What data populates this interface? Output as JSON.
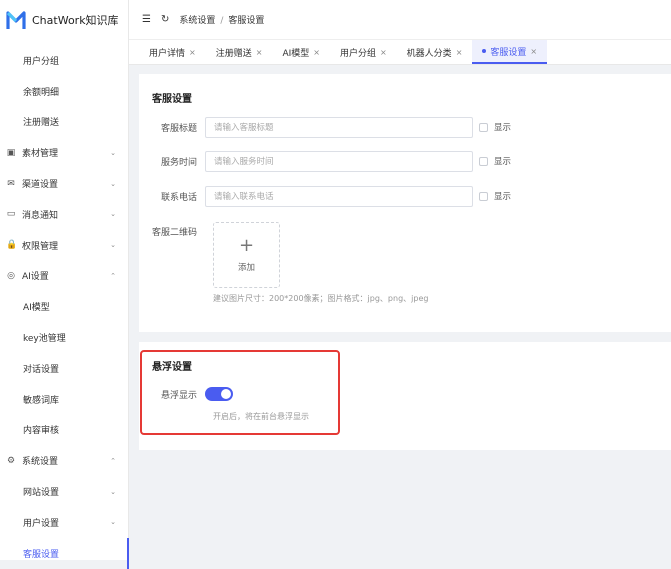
{
  "app": {
    "title": "ChatWork知识库"
  },
  "sidebar": {
    "items": [
      {
        "label": "用户分组",
        "kind": "sub"
      },
      {
        "label": "余额明细",
        "kind": "sub"
      },
      {
        "label": "注册赠送",
        "kind": "sub"
      },
      {
        "label": "素材管理",
        "kind": "grp",
        "icon": "image-icon",
        "glyph": "▣",
        "chev": "⌄"
      },
      {
        "label": "渠道设置",
        "kind": "grp",
        "icon": "mail-icon",
        "glyph": "✉",
        "chev": "⌄"
      },
      {
        "label": "消息通知",
        "kind": "grp",
        "icon": "message-icon",
        "glyph": "▭",
        "chev": "⌄"
      },
      {
        "label": "权限管理",
        "kind": "grp",
        "icon": "lock-icon",
        "glyph": "🔒",
        "chev": "⌄"
      },
      {
        "label": "AI设置",
        "kind": "grp",
        "icon": "ai-icon",
        "glyph": "◎",
        "chev": "⌃"
      },
      {
        "label": "AI模型",
        "kind": "sub"
      },
      {
        "label": "key池管理",
        "kind": "sub"
      },
      {
        "label": "对话设置",
        "kind": "sub"
      },
      {
        "label": "敏感词库",
        "kind": "sub"
      },
      {
        "label": "内容审核",
        "kind": "sub"
      },
      {
        "label": "系统设置",
        "kind": "grp",
        "icon": "gear-icon",
        "glyph": "⚙",
        "chev": "⌃"
      },
      {
        "label": "网站设置",
        "kind": "sub",
        "chev": "⌄"
      },
      {
        "label": "用户设置",
        "kind": "sub",
        "chev": "⌄"
      },
      {
        "label": "客服设置",
        "kind": "sub",
        "active": true
      }
    ]
  },
  "header": {
    "menu_icon": "☰",
    "refresh_icon": "↻",
    "breadcrumb": [
      "系统设置",
      "客服设置"
    ],
    "separator": "/"
  },
  "tabs": [
    {
      "label": "用户详情",
      "close": "×"
    },
    {
      "label": "注册赠送",
      "close": "×"
    },
    {
      "label": "AI模型",
      "close": "×"
    },
    {
      "label": "用户分组",
      "close": "×"
    },
    {
      "label": "机器人分类",
      "close": "×"
    },
    {
      "label": "客服设置",
      "close": "×",
      "active": true
    }
  ],
  "service": {
    "title": "客服设置",
    "fields": [
      {
        "label": "客服标题",
        "placeholder": "请输入客服标题",
        "check_label": "显示"
      },
      {
        "label": "服务时间",
        "placeholder": "请输入服务时间",
        "check_label": "显示"
      },
      {
        "label": "联系电话",
        "placeholder": "请输入联系电话",
        "check_label": "显示"
      }
    ],
    "qrcode_label": "客服二维码",
    "upload_plus": "+",
    "upload_add": "添加",
    "hint": "建议图片尺寸：200*200像素；图片格式：jpg、png、jpeg"
  },
  "float": {
    "title": "悬浮设置",
    "toggle_label": "悬浮显示",
    "toggle_on": true,
    "hint": "开启后，将在前台悬浮显示"
  },
  "colors": {
    "accent": "#4a5cf0",
    "highlight": "#e53935"
  }
}
